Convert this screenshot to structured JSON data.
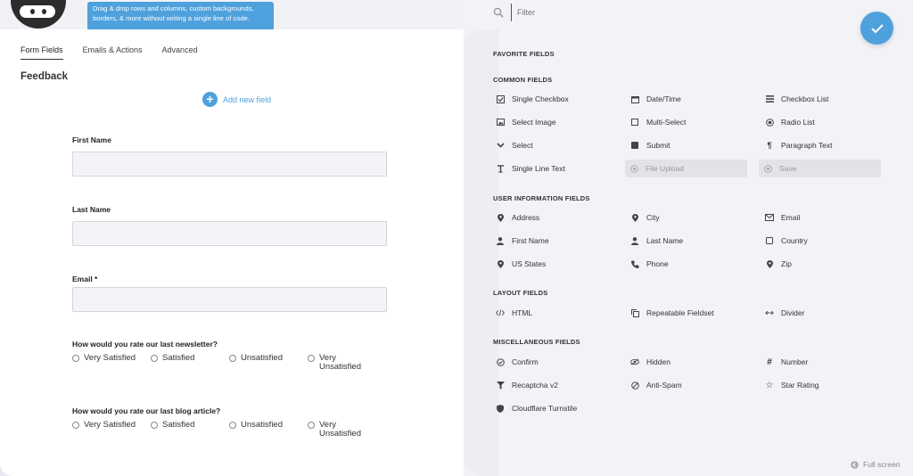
{
  "header": {
    "tooltip": "Drag & drop rows and columns, custom backgrounds, borders, & more without writing a single line of code."
  },
  "tabs": [
    {
      "label": "Form Fields",
      "active": true
    },
    {
      "label": "Emails & Actions",
      "active": false
    },
    {
      "label": "Advanced",
      "active": false
    }
  ],
  "form": {
    "title": "Feedback",
    "add_field_label": "Add new field",
    "fields": {
      "first_name": "First Name",
      "last_name": "Last Name",
      "email": "Email *"
    },
    "question1": {
      "label": "How would you rate our last newsletter?",
      "options": [
        "Very Satisfied",
        "Satisfied",
        "Unsatisfied",
        "Very Unsatisfied"
      ]
    },
    "question2": {
      "label": "How would you rate our last blog article?",
      "options": [
        "Very Satisfied",
        "Satisfied",
        "Unsatisfied",
        "Very Unsatisfied"
      ]
    }
  },
  "panel": {
    "filter_placeholder": "Filter",
    "sections": {
      "favorite": "FAVORITE FIELDS",
      "common": "COMMON FIELDS",
      "user_info": "USER INFORMATION FIELDS",
      "layout": "LAYOUT FIELDS",
      "misc": "MISCELLANEOUS FIELDS"
    },
    "common": [
      "Single Checkbox",
      "Date/Time",
      "Checkbox List",
      "Select Image",
      "Multi-Select",
      "Radio List",
      "Select",
      "Submit",
      "Paragraph Text",
      "Single Line Text",
      "File Upload",
      "Save"
    ],
    "user_info": [
      "Address",
      "City",
      "Email",
      "First Name",
      "Last Name",
      "Country",
      "US States",
      "Phone",
      "Zip"
    ],
    "layout": [
      "HTML",
      "Repeatable Fieldset",
      "Divider"
    ],
    "misc": [
      "Confirm",
      "Hidden",
      "Number",
      "Recaptcha v2",
      "Anti-Spam",
      "Star Rating",
      "Cloudflare Turnstile"
    ],
    "fullscreen_label": "Full screen"
  },
  "colors": {
    "accent": "#4ea1dd",
    "panel_bg": "#f2f3f6",
    "disabled_bg": "#e2e3e8"
  }
}
